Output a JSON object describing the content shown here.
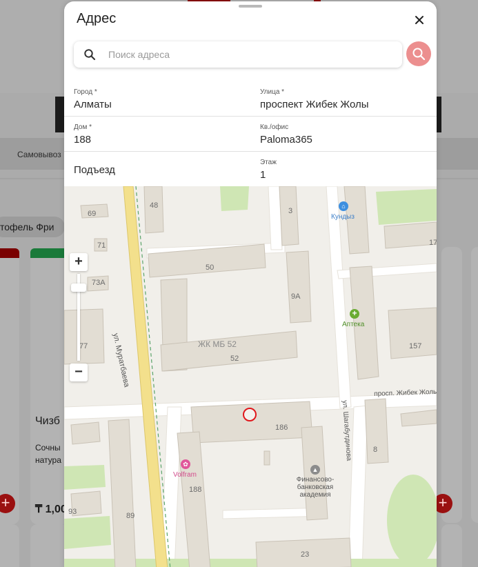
{
  "background": {
    "strip_label": "Самовывоз",
    "category_chip": "тофель Фри",
    "card_title": "Чизб",
    "card_desc_line1": "Сочны",
    "card_desc_line2": "натура",
    "card_price": "₸ 1,00",
    "plus_label": "+"
  },
  "modal": {
    "title": "Адрес",
    "close_icon": "close-icon",
    "search": {
      "placeholder": "Поиск адреса",
      "value": "",
      "icon": "search-icon",
      "button_icon": "search-icon",
      "button_color": "#ec8f8f"
    },
    "fields": {
      "city": {
        "label": "Город *",
        "value": "Алматы"
      },
      "street": {
        "label": "Улица *",
        "value": "проспект Жибек Жолы"
      },
      "house": {
        "label": "Дом *",
        "value": "188"
      },
      "apartment": {
        "label": "Кв./офис",
        "value": "Paloma365"
      },
      "entrance": {
        "label": "Подъезд",
        "value": ""
      },
      "floor": {
        "label": "Этаж",
        "value": "1"
      }
    },
    "map": {
      "zoom_in": "+",
      "zoom_out": "−",
      "labels": {
        "b48": "48",
        "b69": "69",
        "b71": "71",
        "b73a": "73А",
        "b77": "77",
        "b50": "50",
        "b3": "3",
        "b9a": "9А",
        "b52": "52",
        "zhk": "ЖК МБ 52",
        "b157": "157",
        "b17": "17",
        "b186": "186",
        "b8": "8",
        "b188": "188",
        "b93": "93",
        "b89": "89",
        "b23": "23",
        "kundyz": "Кундыз",
        "apteka": "Аптека",
        "volfram": "Volfram",
        "academy1": "Финансово-",
        "academy2": "банковская",
        "academy3": "академия",
        "street_muratbaeva": "ул. Муратбаева",
        "street_zhibek": "просп. Жибек Жолы",
        "street_shagabutdinova": "ул. Шагабутдинова"
      },
      "marker_color": "#e0161b",
      "poi_colors": {
        "kundyz": "#3d8fe0",
        "apteka": "#6aab32",
        "volfram": "#e0569a",
        "academy": "#8c8c8c"
      }
    }
  }
}
